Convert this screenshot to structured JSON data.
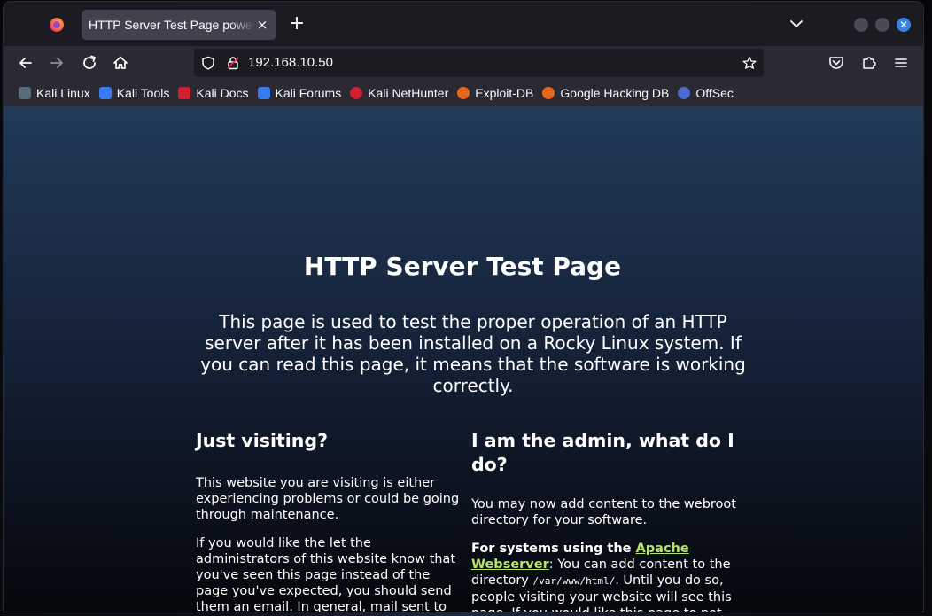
{
  "browser": {
    "tab_title": "HTTP Server Test Page powered by: Rocky Linux",
    "tab_close": "×",
    "new_tab": "+",
    "url": "192.168.10.50"
  },
  "bookmarks": [
    {
      "label": "Kali Linux",
      "icon": "kali-dragon-icon",
      "color": "#5a6b7d"
    },
    {
      "label": "Kali Tools",
      "icon": "kali-tools-icon",
      "color": "#367bf0"
    },
    {
      "label": "Kali Docs",
      "icon": "kali-docs-icon",
      "color": "#d11f2f"
    },
    {
      "label": "Kali Forums",
      "icon": "kali-forums-icon",
      "color": "#367bf0"
    },
    {
      "label": "Kali NetHunter",
      "icon": "kali-nethunter-icon",
      "color": "#d11f2f"
    },
    {
      "label": "Exploit-DB",
      "icon": "exploit-db-icon",
      "color": "#e8661c"
    },
    {
      "label": "Google Hacking DB",
      "icon": "ghdb-icon",
      "color": "#e8661c"
    },
    {
      "label": "OffSec",
      "icon": "offsec-icon",
      "color": "#4d6bd1"
    }
  ],
  "page": {
    "title": "HTTP Server Test Page",
    "lead": "This page is used to test the proper operation of an HTTP server after it has been installed on a Rocky Linux system. If you can read this page, it means that the software is working correctly.",
    "left": {
      "heading": "Just visiting?",
      "p1": "This website you are visiting is either experiencing problems or could be going through maintenance.",
      "p2": "If you would like the let the administrators of this website know that you've seen this page instead of the page you've expected, you should send them an email. In general, mail sent to"
    },
    "right": {
      "heading": "I am the admin, what do I do?",
      "p1": "You may now add content to the webroot directory for your software.",
      "p2_bold": "For systems using the ",
      "p2_link": "Apache Webserver",
      "p2_a": ": You can add content to the directory ",
      "p2_code": "/var/www/html/",
      "p2_b": ". Until you do so, people visiting your website will see this page. If you would like this page to not"
    }
  }
}
